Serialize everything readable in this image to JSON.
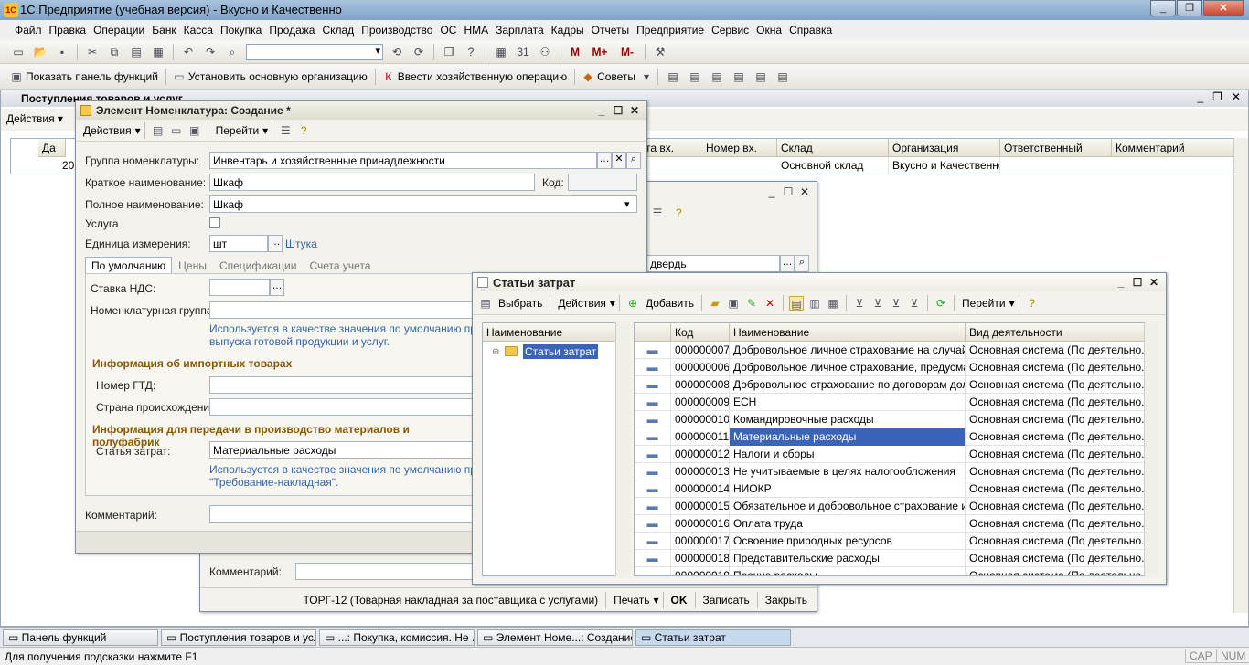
{
  "app": {
    "title": "1С:Предприятие (учебная версия) - Вкусно и Качественно",
    "logo": "1С"
  },
  "menu": [
    "Файл",
    "Правка",
    "Операции",
    "Банк",
    "Касса",
    "Покупка",
    "Продажа",
    "Склад",
    "Производство",
    "ОС",
    "НМА",
    "Зарплата",
    "Кадры",
    "Отчеты",
    "Предприятие",
    "Сервис",
    "Окна",
    "Справка"
  ],
  "toolbar2": {
    "m": "M",
    "mplus": "M+",
    "mminus": "M-"
  },
  "toolbar3": {
    "panel": "Показать панель функций",
    "org": "Установить основную организацию",
    "op": "Ввести хозяйственную операцию",
    "tips": "Советы"
  },
  "docs": {
    "title": "Поступления товаров и услуг",
    "actions": "Действия",
    "cols": [
      "Да",
      "та вх.",
      "Номер вх.",
      "Склад",
      "Организация",
      "Ответственный",
      "Комментарий"
    ],
    "row": {
      "date": "20",
      "warehouse": "Основной склад",
      "org": "Вкусно и Качественно"
    }
  },
  "doc2": {
    "partner_field": "двердь",
    "comment_label": "Комментарий:",
    "footer": {
      "torg": "ТОРГ-12 (Товарная накладная за поставщика с услугами)",
      "print": "Печать",
      "ok": "OK",
      "save": "Записать",
      "close": "Закрыть"
    }
  },
  "elem": {
    "title": "Элемент Номенклатура: Создание *",
    "actions": "Действия",
    "goto": "Перейти",
    "group_label": "Группа номенклатуры:",
    "group_value": "Инвентарь и хозяйственные принадлежности",
    "short_label": "Краткое наименование:",
    "short_value": "Шкаф",
    "code_label": "Код:",
    "full_label": "Полное наименование:",
    "full_value": "Шкаф",
    "service_label": "Услуга",
    "unit_label": "Единица измерения:",
    "unit_value": "шт",
    "unit_link": "Штука",
    "tabs": [
      "По умолчанию",
      "Цены",
      "Спецификации",
      "Счета учета"
    ],
    "vat_label": "Ставка НДС:",
    "nomgroup_label": "Номенклатурная группа:",
    "hint1a": "Используется в качестве значения по умолчанию при вв",
    "hint1b": "выпуска готовой продукции и услуг.",
    "import_title": "Информация об импортных товарах",
    "gtd_label": "Номер ГТД:",
    "country_label": "Страна происхождения:",
    "prod_title": "Информация для передачи в производство материалов и полуфабрик",
    "cost_label": "Статья затрат:",
    "cost_value": "Материальные расходы",
    "hint2a": "Используется в качестве значения по умолчанию при вв",
    "hint2b": "\"Требование-накладная\".",
    "comment_label": "Комментарий:"
  },
  "costs": {
    "title": "Статьи затрат",
    "select": "Выбрать",
    "actions": "Действия",
    "add": "Добавить",
    "goto": "Перейти",
    "tree_header": "Наименование",
    "tree_root": "Статьи затрат",
    "cols": {
      "code": "Код",
      "name": "Наименование",
      "activity": "Вид деятельности"
    },
    "rows": [
      {
        "code": "000000007",
        "name": "Добровольное личное страхование на случай н...",
        "activity": "Основная система (По деятельно..."
      },
      {
        "code": "000000006",
        "name": "Добровольное личное страхование, предусмат...",
        "activity": "Основная система (По деятельно..."
      },
      {
        "code": "000000008",
        "name": "Добровольное страхование по договорам долг...",
        "activity": "Основная система (По деятельно..."
      },
      {
        "code": "000000009",
        "name": "ЕСН",
        "activity": "Основная система (По деятельно..."
      },
      {
        "code": "000000010",
        "name": "Командировочные расходы",
        "activity": "Основная система (По деятельно..."
      },
      {
        "code": "000000011",
        "name": "Материальные расходы",
        "activity": "Основная система (По деятельно..."
      },
      {
        "code": "000000012",
        "name": "Налоги и сборы",
        "activity": "Основная система (По деятельно..."
      },
      {
        "code": "000000013",
        "name": "Не учитываемые в целях налогообложения",
        "activity": "Основная система (По деятельно..."
      },
      {
        "code": "000000014",
        "name": "НИОКР",
        "activity": "Основная система (По деятельно..."
      },
      {
        "code": "000000015",
        "name": "Обязательное и добровольное страхование им...",
        "activity": "Основная система (По деятельно..."
      },
      {
        "code": "000000016",
        "name": "Оплата труда",
        "activity": "Основная система (По деятельно..."
      },
      {
        "code": "000000017",
        "name": "Освоение природных ресурсов",
        "activity": "Основная система (По деятельно..."
      },
      {
        "code": "000000018",
        "name": "Представительские расходы",
        "activity": "Основная система (По деятельно..."
      },
      {
        "code": "000000019",
        "name": "Прочие расходы",
        "activity": "Основная система (По деятельно..."
      }
    ],
    "selected_index": 5
  },
  "taskbar": [
    "Панель функций",
    "Поступления товаров и услуг",
    "...: Покупка, комиссия. Не ...",
    "Элемент Номе...: Создание *",
    "Статьи затрат"
  ],
  "status": {
    "hint": "Для получения подсказки нажмите F1",
    "cap": "CAP",
    "num": "NUM"
  }
}
